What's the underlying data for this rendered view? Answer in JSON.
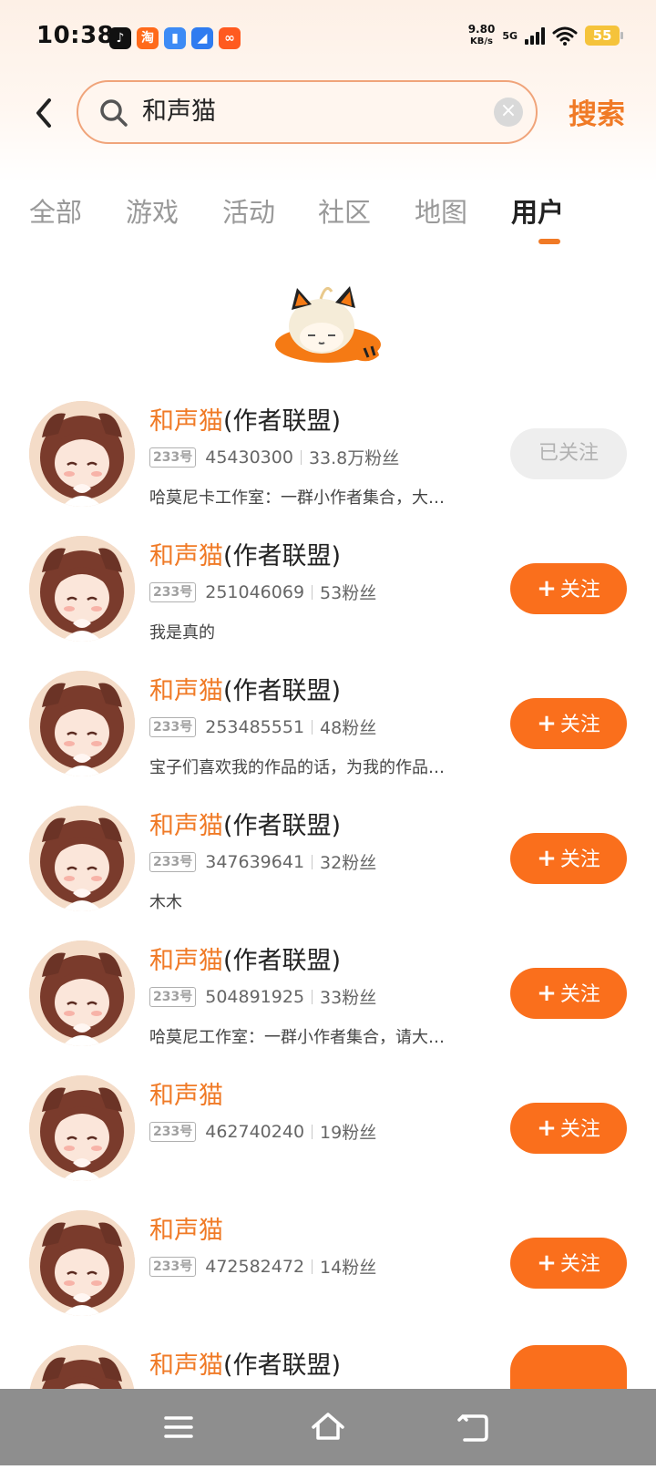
{
  "status_bar": {
    "time": "10:38",
    "net_speed_value": "9.80",
    "net_speed_unit": "KB/s",
    "network_type": "5G",
    "battery": "55",
    "app_icons": [
      "tiktok-icon",
      "taobao-icon",
      "files-icon",
      "notes-icon",
      "app-icon"
    ]
  },
  "search": {
    "query": "和声猫",
    "button_label": "搜索"
  },
  "tabs": [
    {
      "label": "全部"
    },
    {
      "label": "游戏"
    },
    {
      "label": "活动"
    },
    {
      "label": "社区"
    },
    {
      "label": "地图"
    },
    {
      "label": "用户",
      "active": true
    }
  ],
  "colors": {
    "accent": "#f07a26",
    "button": "#fa6f1c"
  },
  "users": [
    {
      "name_highlight": "和声猫",
      "name_rest": "(作者联盟)",
      "tag": "233号",
      "id": "45430300",
      "fans": "33.8万粉丝",
      "desc": "哈莫尼卡工作室：一群小作者集合，大…",
      "button": "已关注",
      "followed": true
    },
    {
      "name_highlight": "和声猫",
      "name_rest": "(作者联盟)",
      "tag": "233号",
      "id": "251046069",
      "fans": "53粉丝",
      "desc": "我是真的",
      "button": "关注",
      "followed": false
    },
    {
      "name_highlight": "和声猫",
      "name_rest": "(作者联盟)",
      "tag": "233号",
      "id": "253485551",
      "fans": "48粉丝",
      "desc": "宝子们喜欢我的作品的话，为我的作品…",
      "button": "关注",
      "followed": false
    },
    {
      "name_highlight": "和声猫",
      "name_rest": "(作者联盟)",
      "tag": "233号",
      "id": "347639641",
      "fans": "32粉丝",
      "desc": "木木",
      "button": "关注",
      "followed": false
    },
    {
      "name_highlight": "和声猫",
      "name_rest": "(作者联盟)",
      "tag": "233号",
      "id": "504891925",
      "fans": "33粉丝",
      "desc": "哈莫尼工作室：一群小作者集合，请大…",
      "button": "关注",
      "followed": false
    },
    {
      "name_highlight": "和声猫",
      "name_rest": "",
      "tag": "233号",
      "id": "462740240",
      "fans": "19粉丝",
      "desc": "",
      "button": "关注",
      "followed": false
    },
    {
      "name_highlight": "和声猫",
      "name_rest": "",
      "tag": "233号",
      "id": "472582472",
      "fans": "14粉丝",
      "desc": "",
      "button": "关注",
      "followed": false
    },
    {
      "name_highlight": "和声猫",
      "name_rest": "(作者联盟)",
      "tag": "",
      "id": "",
      "fans": "",
      "desc": "",
      "button": "",
      "followed": false
    }
  ],
  "navbar": {
    "icons": [
      "menu-icon",
      "home-icon",
      "back-icon"
    ]
  }
}
